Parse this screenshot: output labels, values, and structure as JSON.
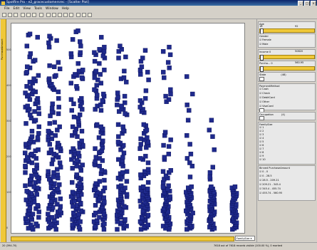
{
  "window": {
    "title": "Spotfire Pro - e2_gracecustomersrec - [Scatter Plot]"
  },
  "menu": [
    "File",
    "Edit",
    "View",
    "Tools",
    "Window",
    "Help"
  ],
  "yaxis": {
    "label": "PurchaseAmount",
    "ticks": [
      "500",
      "400",
      "300",
      "200",
      "100",
      "0"
    ]
  },
  "xaxis": {
    "selector": "FamilySize"
  },
  "panel": {
    "age": {
      "label": "Age",
      "min": "18",
      "max": "92"
    },
    "gender": {
      "label": "Gender",
      "options": [
        "Female",
        "Male"
      ]
    },
    "income": {
      "label": "Income",
      "min": "0",
      "max": "50820"
    },
    "purchase": {
      "label": "Purcha...",
      "min": "0",
      "max": "560.95"
    },
    "state": {
      "label": "State",
      "count": "(48)"
    },
    "payment": {
      "label": "PaymentMethod",
      "options": [
        "Cash",
        "Check",
        "DebitCard",
        "Other",
        "VisaCard"
      ]
    },
    "occupation": {
      "label": "Occupation",
      "count": "(4)"
    },
    "family": {
      "label": "FamilySize",
      "options": [
        "1",
        "2",
        "3",
        "4",
        "5",
        "6",
        "7",
        "8",
        "9",
        "10"
      ]
    },
    "binned": {
      "label": "Binned PurchaseAmount",
      "options": [
        "0 - 0",
        "0 - 28.5",
        "28.5 - 209.21",
        "209.21 - 345.4",
        "345.4 - 455.74",
        "455.74 - 560.95"
      ]
    }
  },
  "status": {
    "left": "20 (394.70)",
    "right": "7618 out of 7618 records visible (100.00 %), 0 marked"
  },
  "colors": {
    "marker": "#1f2a8c",
    "accent": "#f0c838"
  },
  "chart_data": {
    "type": "scatter",
    "x": [
      1,
      2,
      3,
      4,
      5,
      6,
      7,
      8,
      9,
      10
    ],
    "xlabel": "FamilySize",
    "ylabel": "PurchaseAmount",
    "ylim": [
      0,
      560
    ],
    "column_tops": [
      545,
      550,
      548,
      535,
      520,
      510,
      505,
      430,
      380,
      120
    ]
  }
}
